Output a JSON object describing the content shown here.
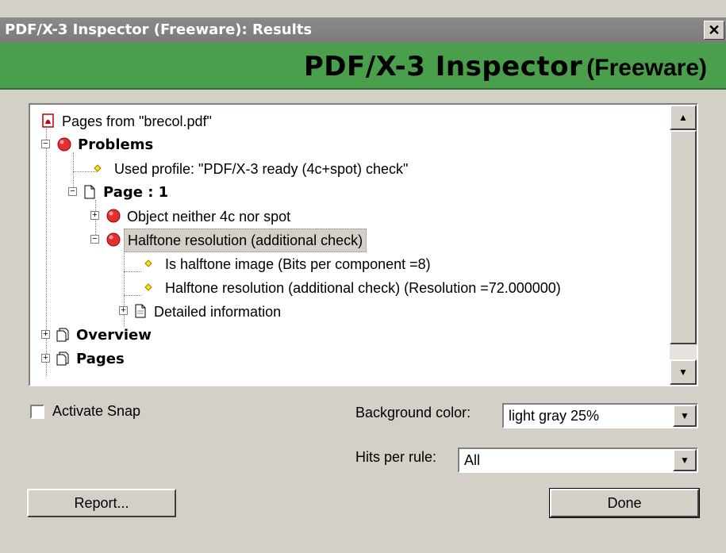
{
  "window": {
    "title": "PDF/X-3 Inspector (Freeware): Results",
    "close_glyph": "✕"
  },
  "banner": {
    "title_bold": "PDF/X-3 Inspector",
    "title_suffix": "(Freeware)"
  },
  "tree": {
    "root": "Pages from \"brecol.pdf\"",
    "problems": "Problems",
    "used_profile": "Used profile: \"PDF/X-3 ready (4c+spot) check\"",
    "page": "Page : 1",
    "object_neither": "Object neither 4c nor spot",
    "halftone_res": "Halftone resolution (additional check)",
    "is_halftone": "Is halftone image (Bits per component =8)",
    "halftone_res_detail": "Halftone resolution (additional check) (Resolution =72.000000)",
    "detailed_info": "Detailed information",
    "overview": "Overview",
    "pages": "Pages",
    "expand_minus": "−",
    "expand_plus": "+"
  },
  "scroll": {
    "up": "▲",
    "down": "▼"
  },
  "options": {
    "activate_snap": "Activate Snap",
    "activate_snap_checked": false,
    "background_color_label": "Background color:",
    "background_color_value": "light gray 25%",
    "hits_per_rule_label": "Hits per rule:",
    "hits_per_rule_value": "All",
    "dropdown_arrow": "▼"
  },
  "buttons": {
    "report": "Report...",
    "done": "Done"
  },
  "colors": {
    "banner_green": "#4a9f4c",
    "title_gray": "#808080",
    "problem_red": "#e03030",
    "info_yellow": "#ffe400"
  }
}
